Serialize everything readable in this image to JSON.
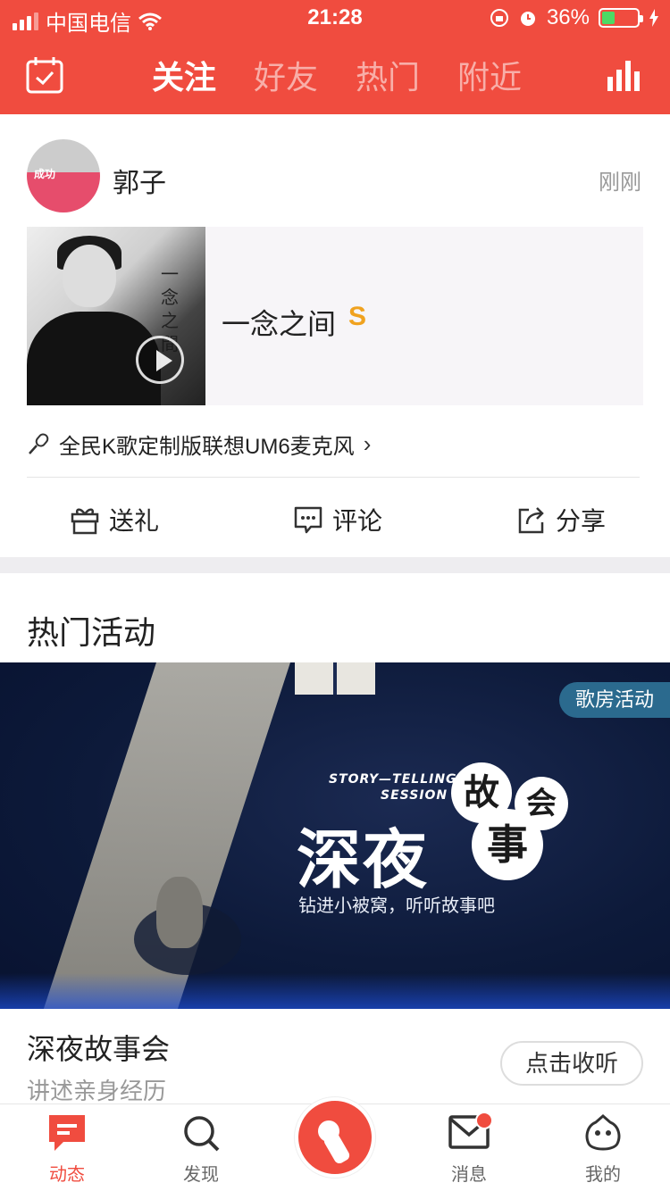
{
  "status_bar": {
    "carrier": "中国电信",
    "time": "21:28",
    "battery_percent": "36%",
    "battery_level": 0.36
  },
  "nav": {
    "tabs": [
      "关注",
      "好友",
      "热门",
      "附近"
    ],
    "active_tab": "关注"
  },
  "feed_card": {
    "user_name": "郭子",
    "post_time": "刚刚",
    "avatar_text": "成功",
    "song": {
      "cover_text": "一念之間",
      "title": "一念之间",
      "grade": "S"
    },
    "device_text": "全民K歌定制版联想UM6麦克风",
    "actions": {
      "gift": "送礼",
      "comment": "评论",
      "share": "分享"
    }
  },
  "hot_events": {
    "section_title": "热门活动",
    "banner": {
      "badge": "歌房活动",
      "subtitle_line1": "STORY—TELLING",
      "subtitle_line2": "SESSION",
      "main_text": "深夜",
      "circle_1": "故",
      "circle_2": "会",
      "circle_3": "事",
      "slogan": "钻进小被窝，听听故事吧"
    },
    "event_title": "深夜故事会",
    "event_desc": "讲述亲身经历",
    "listen_button": "点击收听"
  },
  "tab_bar": {
    "items": {
      "feed": "动态",
      "discover": "发现",
      "messages": "消息",
      "me": "我的"
    },
    "active": "feed"
  },
  "colors": {
    "brand_red": "#f04c3f",
    "grade_gold": "#f0a21f",
    "badge_blue": "#2b6a8e"
  },
  "icons": [
    "signal-icon",
    "wifi-icon",
    "lock-rotation-icon",
    "alarm-icon",
    "battery-icon",
    "calendar-check-icon",
    "ranking-icon",
    "play-icon",
    "microphone-icon",
    "chevron-right-icon",
    "gift-icon",
    "comment-icon",
    "share-icon",
    "feed-icon",
    "search-icon",
    "sing-icon",
    "mail-icon",
    "profile-icon"
  ]
}
